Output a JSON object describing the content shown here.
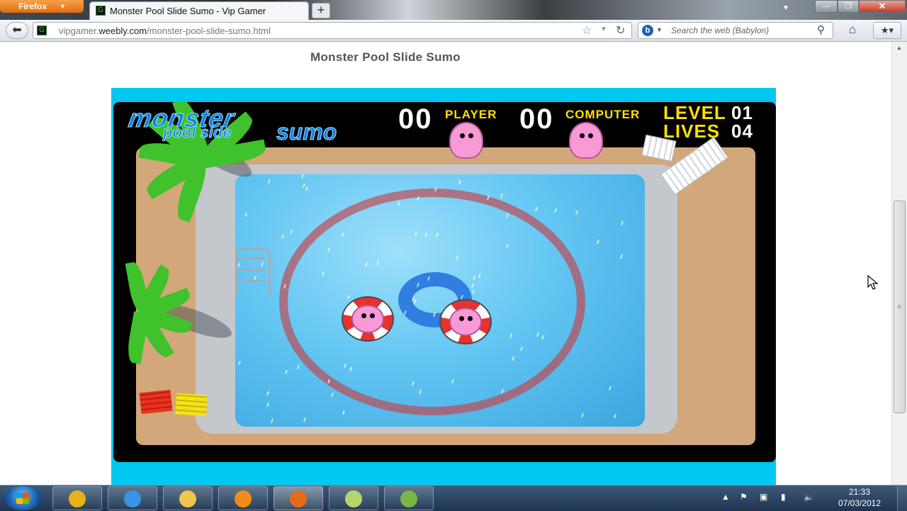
{
  "browser": {
    "app_button_label": "Firefox",
    "tab_title": "Monster Pool Slide Sumo - Vip Gamer",
    "new_tab_label": "+",
    "url_prefix": "vipgamer.",
    "url_domain": "weebly.com",
    "url_path": "/monster-pool-slide-sumo.html",
    "search_placeholder": "Search the web (Babylon)"
  },
  "page": {
    "title": "Monster Pool Slide Sumo"
  },
  "game": {
    "logo_line1": "monster",
    "logo_line2": "pool side",
    "logo_line3": "sumo",
    "player_score": "00",
    "player_label": "PLAYER",
    "computer_score": "00",
    "computer_label": "COMPUTER",
    "level_label": "LEVEL",
    "level_value": "01",
    "lives_label": "LIVES",
    "lives_value": "04"
  },
  "taskbar": {
    "apps": [
      {
        "name": "chrome-icon",
        "color": "#e8b21d"
      },
      {
        "name": "internet-explorer-icon",
        "color": "#3a93e6"
      },
      {
        "name": "file-explorer-icon",
        "color": "#f1c64d"
      },
      {
        "name": "media-player-icon",
        "color": "#f38b1b"
      },
      {
        "name": "firefox-icon",
        "color": "#e66b1d"
      },
      {
        "name": "notes-icon",
        "color": "#b9d36c"
      },
      {
        "name": "paint-icon",
        "color": "#7ab548"
      }
    ],
    "time": "21:33",
    "date": "07/03/2012"
  },
  "colors": {
    "game_frame": "#00c8f0",
    "hud_yellow": "#ffe000",
    "monster_pink": "#f79ad6",
    "ring_red": "#c4424a"
  }
}
